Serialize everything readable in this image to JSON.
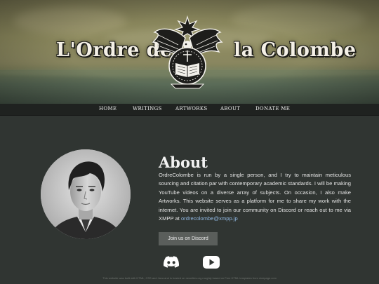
{
  "banner": {
    "title_left": "L'Ordre de",
    "title_right": "la Colombe"
  },
  "nav": {
    "items": [
      {
        "label": "HOME"
      },
      {
        "label": "WRITINGS"
      },
      {
        "label": "ARTWORKS"
      },
      {
        "label": "ABOUT"
      },
      {
        "label": "DONATE ME"
      }
    ]
  },
  "about": {
    "heading": "About",
    "body_text": "OrdreColombe is run by a single person, and I try to maintain meticulous sourcing and citation par with contemporary academic standards. I will be making YouTube videos on a diverse array of subjects. On occasion, I also make Artworks. This website serves as a platform for me to share my work with the internet. You are invited to join our community on Discord or reach out to me via XMPP at",
    "email": "ordrecolombe@xmpp.jp",
    "discord_button": "Join us on Discord"
  },
  "social": {
    "discord_icon": "discord-icon",
    "youtube_icon": "youtube-icon"
  },
  "footer": {
    "text": "This website was built with HTML, CSS and Java and is hosted on neocities.org roughly based on Free HTML templates from nicepage.com"
  },
  "colors": {
    "background": "#303532",
    "nav": "#1f2220",
    "link": "#8fb6e0",
    "button": "#5a5e5b"
  }
}
